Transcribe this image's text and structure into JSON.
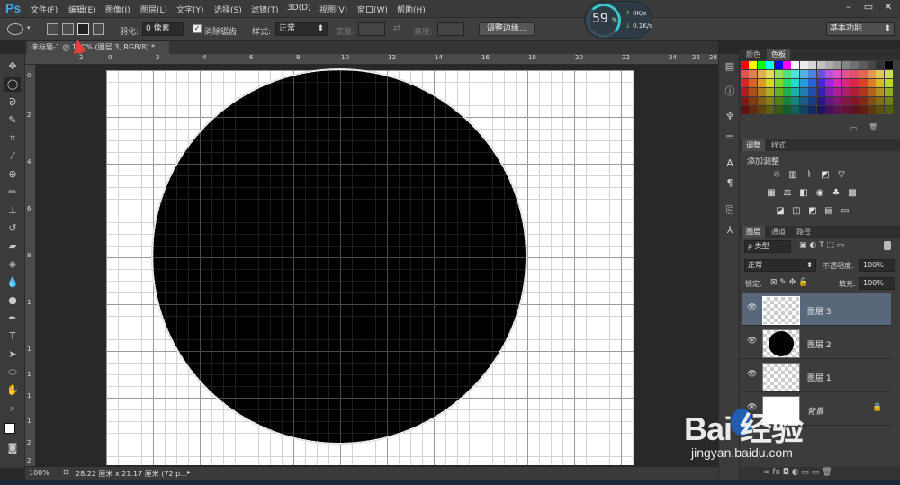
{
  "app": {
    "logo": "Ps",
    "menu": [
      "文件(F)",
      "编辑(E)",
      "图像(I)",
      "图层(L)",
      "文字(Y)",
      "选择(S)",
      "滤镜(T)",
      "3D(D)",
      "视图(V)",
      "窗口(W)",
      "帮助(H)"
    ],
    "window_buttons": [
      "–",
      "▭",
      "✕"
    ]
  },
  "options": {
    "feather_label": "羽化:",
    "feather_value": "0 像素",
    "antialias_label": "消除锯齿",
    "antialias_checked": true,
    "style_label": "样式:",
    "style_value": "正常",
    "width_label": "宽度:",
    "height_label": "高度:",
    "refine_edge_button": "调整边缘...",
    "workspace_value": "基本功能"
  },
  "speed_widget": {
    "percent": "59",
    "percent_suffix": "%",
    "up": "0K/s",
    "down": "0.1K/s"
  },
  "document": {
    "tab_title": "未标题-1 @ 100% (图层 3, RGB/8) *",
    "ruler_top_ticks": [
      "2",
      "0",
      "2",
      "4",
      "6",
      "8",
      "10",
      "12",
      "14",
      "16",
      "18",
      "20",
      "22",
      "24",
      "26",
      "28"
    ],
    "ruler_left_ticks": [
      "0",
      "2",
      "4",
      "6",
      "8",
      "1",
      "1",
      "1",
      "1",
      "1",
      "2",
      "2"
    ]
  },
  "status": {
    "zoom": "100%",
    "doc_size": "28.22 厘米 x 21.17 厘米 (72 p..."
  },
  "panels": {
    "color_tabs": [
      "颜色",
      "色板"
    ],
    "adjust_tabs": [
      "调整",
      "样式"
    ],
    "adjust_title": "添加调整",
    "layers_tabs": [
      "图层",
      "通道",
      "路径"
    ],
    "filter_kind": "ρ 类型",
    "blend_mode": "正常",
    "opacity_label": "不透明度:",
    "opacity_value": "100%",
    "lock_label": "锁定:",
    "fill_label": "填充:",
    "fill_value": "100%",
    "layers": [
      {
        "name": "图层 3",
        "selected": true,
        "thumb": "transparent"
      },
      {
        "name": "图层 2",
        "selected": false,
        "thumb": "circle"
      },
      {
        "name": "图层 1",
        "selected": false,
        "thumb": "transparent"
      },
      {
        "name": "背景",
        "selected": false,
        "thumb": "white",
        "locked": true
      }
    ]
  },
  "swatch_colors": [
    "#ff0000",
    "#ffff00",
    "#00ff00",
    "#00ffff",
    "#0000ff",
    "#ff00ff",
    "#ffffff",
    "#ebebeb",
    "#d6d6d6",
    "#c2c2c2",
    "#adadad",
    "#999999",
    "#858585",
    "#707070",
    "#5c5c5c",
    "#474747",
    "#333333",
    "#000000"
  ],
  "watermark": {
    "logo": "Bai  经验",
    "url": "jingyan.baidu.com"
  }
}
